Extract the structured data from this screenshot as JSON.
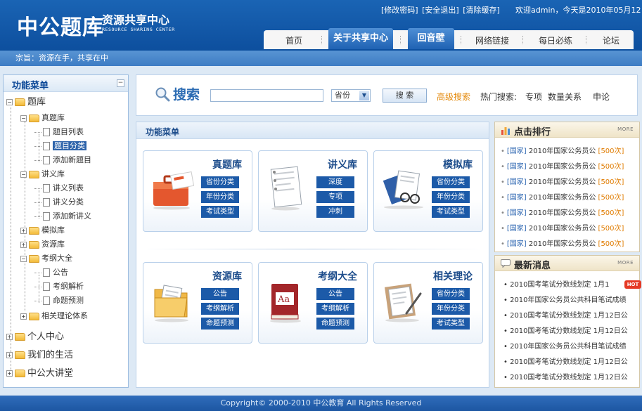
{
  "header": {
    "logo": "中公题库",
    "subtitle": "资源共享中心",
    "subtitle_en": "RESOURCE SHARING CENTER",
    "top_links": [
      "[修改密码]",
      "[安全退出]",
      "[清除缓存]"
    ],
    "welcome": "欢迎admin，今天是2010年05月12日"
  },
  "nav": {
    "items": [
      "首页",
      "关于共享中心",
      "回音壁",
      "网络链接",
      "每日必练",
      "论坛"
    ]
  },
  "motto": "宗旨：资源在手，共享在中",
  "sidebar": {
    "title": "功能菜单",
    "tree": [
      "题库",
      "真题库",
      "题目列表",
      "题目分类",
      "添加新题目",
      "讲义库",
      "讲义列表",
      "讲义分类",
      "添加新讲义",
      "模拟库",
      "资源库",
      "考纲大全",
      "公告",
      "考纲解析",
      "命题预测",
      "相关理论体系",
      "个人中心",
      "我们的生活",
      "中公大讲堂"
    ]
  },
  "search": {
    "title": "搜索",
    "input_value": "",
    "select_value": "省份",
    "button": "搜 索",
    "advanced": "高级搜索",
    "hot_label": "热门搜索:",
    "hot_terms": [
      "专项",
      "数量关系",
      "申论"
    ]
  },
  "func": {
    "title": "功能菜单",
    "cards": [
      {
        "title": "真题库",
        "buttons": [
          "省份分类",
          "年份分类",
          "考试类型"
        ]
      },
      {
        "title": "讲义库",
        "buttons": [
          "深度",
          "专项",
          "冲刺"
        ]
      },
      {
        "title": "模拟库",
        "buttons": [
          "省份分类",
          "年份分类",
          "考试类型"
        ]
      },
      {
        "title": "资源库",
        "buttons": [
          "公告",
          "考纲解析",
          "命题预测"
        ]
      },
      {
        "title": "考纲大全",
        "buttons": [
          "公告",
          "考纲解析",
          "命题预测"
        ]
      },
      {
        "title": "相关理论",
        "buttons": [
          "省份分类",
          "年份分类",
          "考试类型"
        ]
      }
    ]
  },
  "ranking": {
    "title": "点击排行",
    "more": "MORE",
    "items": [
      {
        "cat": "[国家]",
        "text": "2010年国家公务员公",
        "count": "[500次]"
      },
      {
        "cat": "[国家]",
        "text": "2010年国家公务员公",
        "count": "[500次]"
      },
      {
        "cat": "[国家]",
        "text": "2010年国家公务员公",
        "count": "[500次]"
      },
      {
        "cat": "[国家]",
        "text": "2010年国家公务员公",
        "count": "[500次]"
      },
      {
        "cat": "[国家]",
        "text": "2010年国家公务员公",
        "count": "[500次]"
      },
      {
        "cat": "[国家]",
        "text": "2010年国家公务员公",
        "count": "[500次]"
      },
      {
        "cat": "[国家]",
        "text": "2010年国家公务员公",
        "count": "[500次]"
      }
    ]
  },
  "news": {
    "title": "最新消息",
    "more": "MORE",
    "hot_badge": "HOT",
    "items": [
      "• 2010国考笔试分数线划定 1月1",
      "• 2010年国家公务员公共科目笔试成绩",
      "• 2010国考笔试分数线划定 1月12日公",
      "• 2010国考笔试分数线划定 1月12日公",
      "• 2010年国家公务员公共科目笔试成绩",
      "• 2010国考笔试分数线划定 1月12日公",
      "• 2010国考笔试分数线划定 1月12日公"
    ]
  },
  "footer": "Copyright© 2000-2010 中公教育 All Rights Reserved",
  "colors": {
    "brand_blue": "#0d4f9e",
    "accent_orange": "#e48a0c",
    "button_blue": "#1c5aa8"
  }
}
